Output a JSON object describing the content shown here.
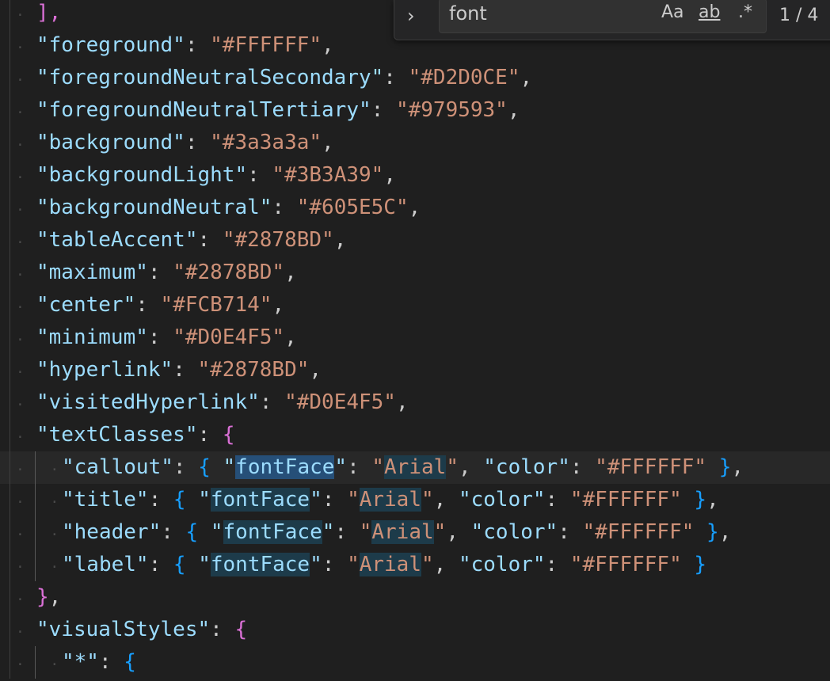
{
  "editor": {
    "lines": [
      {
        "parts": [
          [
            "b1",
            "],"
          ]
        ]
      },
      {
        "parts": [
          [
            "key",
            "\"foreground\""
          ],
          [
            "p",
            ": "
          ],
          [
            "str",
            "\"#FFFFFF\""
          ],
          [
            "p",
            ","
          ]
        ]
      },
      {
        "parts": [
          [
            "key",
            "\"foregroundNeutralSecondary\""
          ],
          [
            "p",
            ": "
          ],
          [
            "str",
            "\"#D2D0CE\""
          ],
          [
            "p",
            ","
          ]
        ]
      },
      {
        "parts": [
          [
            "key",
            "\"foregroundNeutralTertiary\""
          ],
          [
            "p",
            ": "
          ],
          [
            "str",
            "\"#979593\""
          ],
          [
            "p",
            ","
          ]
        ]
      },
      {
        "parts": [
          [
            "key",
            "\"background\""
          ],
          [
            "p",
            ": "
          ],
          [
            "str",
            "\"#3a3a3a\""
          ],
          [
            "p",
            ","
          ]
        ]
      },
      {
        "parts": [
          [
            "key",
            "\"backgroundLight\""
          ],
          [
            "p",
            ": "
          ],
          [
            "str",
            "\"#3B3A39\""
          ],
          [
            "p",
            ","
          ]
        ]
      },
      {
        "parts": [
          [
            "key",
            "\"backgroundNeutral\""
          ],
          [
            "p",
            ": "
          ],
          [
            "str",
            "\"#605E5C\""
          ],
          [
            "p",
            ","
          ]
        ]
      },
      {
        "parts": [
          [
            "key",
            "\"tableAccent\""
          ],
          [
            "p",
            ": "
          ],
          [
            "str",
            "\"#2878BD\""
          ],
          [
            "p",
            ","
          ]
        ]
      },
      {
        "parts": [
          [
            "key",
            "\"maximum\""
          ],
          [
            "p",
            ": "
          ],
          [
            "str",
            "\"#2878BD\""
          ],
          [
            "p",
            ","
          ]
        ]
      },
      {
        "parts": [
          [
            "key",
            "\"center\""
          ],
          [
            "p",
            ": "
          ],
          [
            "str",
            "\"#FCB714\""
          ],
          [
            "p",
            ","
          ]
        ]
      },
      {
        "parts": [
          [
            "key",
            "\"minimum\""
          ],
          [
            "p",
            ": "
          ],
          [
            "str",
            "\"#D0E4F5\""
          ],
          [
            "p",
            ","
          ]
        ]
      },
      {
        "parts": [
          [
            "key",
            "\"hyperlink\""
          ],
          [
            "p",
            ": "
          ],
          [
            "str",
            "\"#2878BD\""
          ],
          [
            "p",
            ","
          ]
        ]
      },
      {
        "parts": [
          [
            "key",
            "\"visitedHyperlink\""
          ],
          [
            "p",
            ": "
          ],
          [
            "str",
            "\"#D0E4F5\""
          ],
          [
            "p",
            ","
          ]
        ]
      },
      {
        "parts": [
          [
            "key",
            "\"textClasses\""
          ],
          [
            "p",
            ": "
          ],
          [
            "b1",
            "{"
          ]
        ]
      },
      {
        "indent": 1,
        "current": true,
        "parts": [
          [
            "key",
            "\"callout\""
          ],
          [
            "p",
            ": "
          ],
          [
            "b2",
            "{ "
          ],
          [
            "key",
            "\""
          ],
          [
            "keyhlcur",
            "fontFace"
          ],
          [
            "key",
            "\""
          ],
          [
            "p",
            ": "
          ],
          [
            "str",
            "\""
          ],
          [
            "strhl",
            "Arial"
          ],
          [
            "str",
            "\""
          ],
          [
            "p",
            ", "
          ],
          [
            "key",
            "\"color\""
          ],
          [
            "p",
            ": "
          ],
          [
            "str",
            "\"#FFFFFF\""
          ],
          [
            "b2",
            " }"
          ],
          [
            "p",
            ","
          ]
        ]
      },
      {
        "indent": 1,
        "parts": [
          [
            "key",
            "\"title\""
          ],
          [
            "p",
            ": "
          ],
          [
            "b2",
            "{ "
          ],
          [
            "key",
            "\""
          ],
          [
            "keyhl",
            "fontFace"
          ],
          [
            "key",
            "\""
          ],
          [
            "p",
            ": "
          ],
          [
            "str",
            "\""
          ],
          [
            "strhl",
            "Arial"
          ],
          [
            "str",
            "\""
          ],
          [
            "p",
            ", "
          ],
          [
            "key",
            "\"color\""
          ],
          [
            "p",
            ": "
          ],
          [
            "str",
            "\"#FFFFFF\""
          ],
          [
            "b2",
            " }"
          ],
          [
            "p",
            ","
          ]
        ]
      },
      {
        "indent": 1,
        "parts": [
          [
            "key",
            "\"header\""
          ],
          [
            "p",
            ": "
          ],
          [
            "b2",
            "{ "
          ],
          [
            "key",
            "\""
          ],
          [
            "keyhl",
            "fontFace"
          ],
          [
            "key",
            "\""
          ],
          [
            "p",
            ": "
          ],
          [
            "str",
            "\""
          ],
          [
            "strhl",
            "Arial"
          ],
          [
            "str",
            "\""
          ],
          [
            "p",
            ", "
          ],
          [
            "key",
            "\"color\""
          ],
          [
            "p",
            ": "
          ],
          [
            "str",
            "\"#FFFFFF\""
          ],
          [
            "b2",
            " }"
          ],
          [
            "p",
            ","
          ]
        ]
      },
      {
        "indent": 1,
        "parts": [
          [
            "key",
            "\"label\""
          ],
          [
            "p",
            ": "
          ],
          [
            "b2",
            "{ "
          ],
          [
            "key",
            "\""
          ],
          [
            "keyhl",
            "fontFace"
          ],
          [
            "key",
            "\""
          ],
          [
            "p",
            ": "
          ],
          [
            "str",
            "\""
          ],
          [
            "strhl",
            "Arial"
          ],
          [
            "str",
            "\""
          ],
          [
            "p",
            ", "
          ],
          [
            "key",
            "\"color\""
          ],
          [
            "p",
            ": "
          ],
          [
            "str",
            "\"#FFFFFF\""
          ],
          [
            "b2",
            " }"
          ]
        ]
      },
      {
        "parts": [
          [
            "b1",
            "}"
          ],
          [
            "p",
            ","
          ]
        ]
      },
      {
        "parts": [
          [
            "key",
            "\"visualStyles\""
          ],
          [
            "p",
            ": "
          ],
          [
            "b1",
            "{"
          ]
        ]
      },
      {
        "indent": 1,
        "parts": [
          [
            "key",
            "\"*\""
          ],
          [
            "p",
            ": "
          ],
          [
            "b2",
            "{"
          ]
        ]
      }
    ]
  },
  "find_widget": {
    "toggle_icon": "chevron-right-icon",
    "toggle_glyph": "›",
    "query": "font",
    "match_case": "Aa",
    "whole_word": "ab",
    "regex": ".*",
    "count": "1 / 4"
  },
  "colors": {
    "background": "#1f1f1f",
    "key": "#9cdcfe",
    "string": "#ce9178",
    "bracket1": "#da70d6",
    "bracket2": "#179fff"
  }
}
